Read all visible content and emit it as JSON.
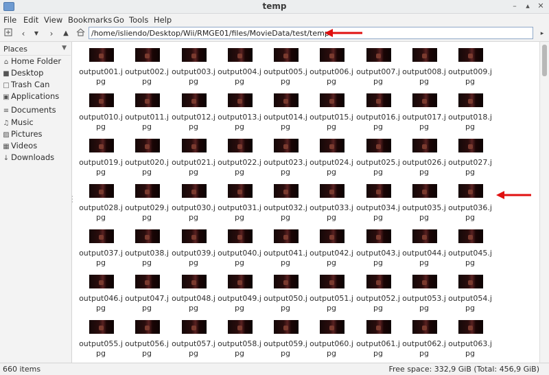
{
  "window": {
    "title": "temp"
  },
  "menu": [
    "File",
    "Edit",
    "View",
    "Bookmarks",
    "Go",
    "Tools",
    "Help"
  ],
  "toolbar": {
    "icons": [
      "new-tab-icon",
      "back-icon",
      "history-dropdown-icon",
      "forward-icon",
      "up-icon",
      "home-icon"
    ]
  },
  "address": {
    "path": "/home/isliendo/Desktop/Wii/RMGE01/files/MovieData/test/temp"
  },
  "sidebar": {
    "header": "Places",
    "items": [
      {
        "label": "Home Folder",
        "icon": "home-icon"
      },
      {
        "label": "Desktop",
        "icon": "desktop-icon"
      },
      {
        "label": "Trash Can",
        "icon": "trash-icon"
      },
      {
        "label": "Applications",
        "icon": "applications-icon"
      },
      {
        "label": "Documents",
        "icon": "documents-icon"
      },
      {
        "label": "Music",
        "icon": "music-icon"
      },
      {
        "label": "Pictures",
        "icon": "pictures-icon"
      },
      {
        "label": "Videos",
        "icon": "videos-icon"
      },
      {
        "label": "Downloads",
        "icon": "downloads-icon"
      }
    ]
  },
  "files": [
    "output001.jpg",
    "output002.jpg",
    "output003.jpg",
    "output004.jpg",
    "output005.jpg",
    "output006.jpg",
    "output007.jpg",
    "output008.jpg",
    "output009.jpg",
    "output010.jpg",
    "output011.jpg",
    "output012.jpg",
    "output013.jpg",
    "output014.jpg",
    "output015.jpg",
    "output016.jpg",
    "output017.jpg",
    "output018.jpg",
    "output019.jpg",
    "output020.jpg",
    "output021.jpg",
    "output022.jpg",
    "output023.jpg",
    "output024.jpg",
    "output025.jpg",
    "output026.jpg",
    "output027.jpg",
    "output028.jpg",
    "output029.jpg",
    "output030.jpg",
    "output031.jpg",
    "output032.jpg",
    "output033.jpg",
    "output034.jpg",
    "output035.jpg",
    "output036.jpg",
    "output037.jpg",
    "output038.jpg",
    "output039.jpg",
    "output040.jpg",
    "output041.jpg",
    "output042.jpg",
    "output043.jpg",
    "output044.jpg",
    "output045.jpg",
    "output046.jpg",
    "output047.jpg",
    "output048.jpg",
    "output049.jpg",
    "output050.jpg",
    "output051.jpg",
    "output052.jpg",
    "output053.jpg",
    "output054.jpg",
    "output055.jpg",
    "output056.jpg",
    "output057.jpg",
    "output058.jpg",
    "output059.jpg",
    "output060.jpg",
    "output061.jpg",
    "output062.jpg",
    "output063.jpg"
  ],
  "status": {
    "items": "660 items",
    "free_space": "Free space: 332,9 GiB (Total: 456,9 GiB)"
  },
  "colors": {
    "annotation_arrow": "#e01010",
    "address_border": "#8fa8c8"
  }
}
